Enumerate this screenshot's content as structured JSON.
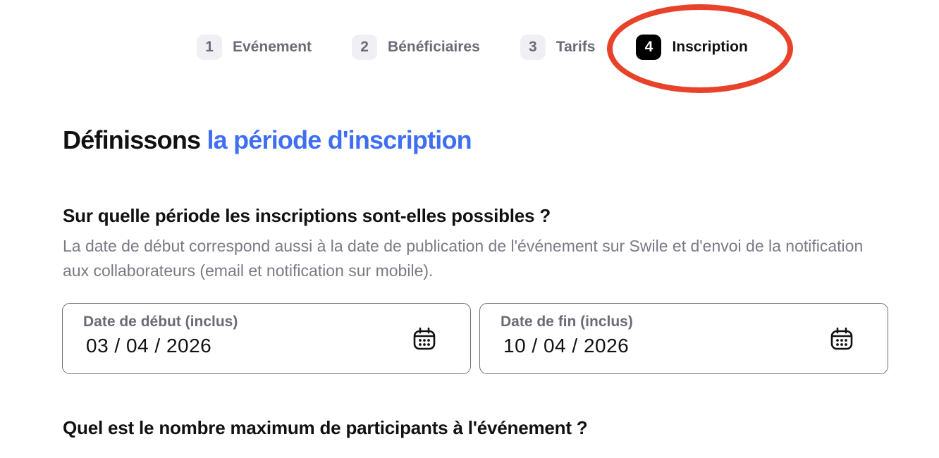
{
  "stepper": {
    "steps": [
      {
        "number": "1",
        "label": "Evénement"
      },
      {
        "number": "2",
        "label": "Bénéficiaires"
      },
      {
        "number": "3",
        "label": "Tarifs"
      },
      {
        "number": "4",
        "label": "Inscription"
      }
    ],
    "active_step": 4,
    "highlight_color": "#e8432a"
  },
  "title": {
    "prefix": "Définissons",
    "accent": "la période d'inscription",
    "accent_color": "#3f6ef2"
  },
  "registration_period": {
    "question": "Sur quelle période les inscriptions sont-elles possibles ?",
    "description": "La date de début correspond aussi à la date de publication de l'événement sur Swile et d'envoi de la notification aux collaborateurs (email et notification sur mobile).",
    "start_date": {
      "label": "Date de début (inclus)",
      "value": "03 / 04 / 2026",
      "icon": "calendar-icon"
    },
    "end_date": {
      "label": "Date de fin (inclus)",
      "value": "10 / 04 / 2026",
      "icon": "calendar-icon"
    }
  },
  "max_participants": {
    "question": "Quel est le nombre maximum de participants à l'événement ?"
  }
}
